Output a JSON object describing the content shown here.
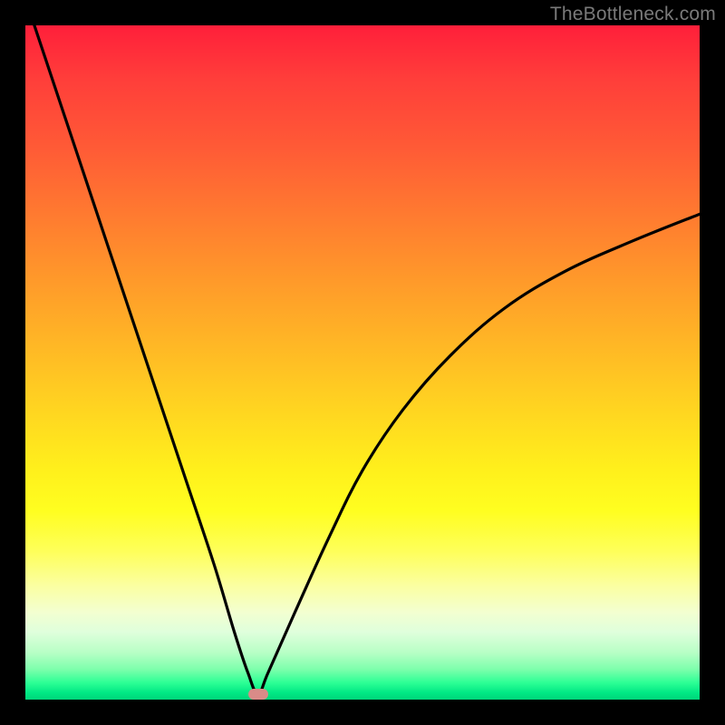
{
  "watermark": "TheBottleneck.com",
  "colors": {
    "frame": "#000000",
    "curve": "#000000",
    "marker": "#d98b88",
    "watermark": "#7a7a7a"
  },
  "chart_data": {
    "type": "line",
    "title": "",
    "xlabel": "",
    "ylabel": "",
    "xlim": [
      0,
      100
    ],
    "ylim": [
      0,
      100
    ],
    "grid": false,
    "legend": false,
    "series": [
      {
        "name": "bottleneck-curve",
        "x": [
          0,
          4,
          8,
          12,
          16,
          20,
          24,
          28,
          31,
          33,
          34.5,
          36,
          40,
          45,
          50,
          56,
          63,
          71,
          80,
          90,
          100
        ],
        "y": [
          104,
          92,
          80,
          68,
          56,
          44,
          32,
          20,
          10,
          4,
          0.8,
          4,
          13,
          24,
          34,
          43,
          51,
          58,
          63.5,
          68,
          72
        ]
      }
    ],
    "marker": {
      "x": 34.5,
      "y": 0.8
    }
  }
}
